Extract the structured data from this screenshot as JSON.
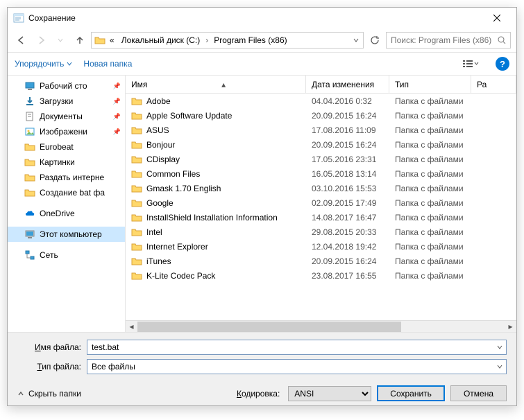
{
  "title": "Сохранение",
  "breadcrumb": {
    "root": "«",
    "seg1": "Локальный диск (C:)",
    "seg2": "Program Files (x86)"
  },
  "search": {
    "placeholder": "Поиск: Program Files (x86)"
  },
  "toolbar": {
    "organize": "Упорядочить",
    "newfolder": "Новая папка"
  },
  "columns": {
    "name": "Имя",
    "date": "Дата изменения",
    "type": "Тип",
    "size": "Ра"
  },
  "sidebar": {
    "quick": [
      {
        "label": "Рабочий сто",
        "pin": true,
        "icon": "desktop"
      },
      {
        "label": "Загрузки",
        "pin": true,
        "icon": "downloads"
      },
      {
        "label": "Документы",
        "pin": true,
        "icon": "documents"
      },
      {
        "label": "Изображени",
        "pin": true,
        "icon": "pictures"
      },
      {
        "label": "Eurobeat",
        "pin": false,
        "icon": "folder"
      },
      {
        "label": "Картинки",
        "pin": false,
        "icon": "folder"
      },
      {
        "label": "Раздать интерне",
        "pin": false,
        "icon": "folder"
      },
      {
        "label": "Создание bat фа",
        "pin": false,
        "icon": "folder"
      }
    ],
    "onedrive": "OneDrive",
    "thispc": "Этот компьютер",
    "network": "Сеть"
  },
  "typeFolder": "Папка с файлами",
  "files": [
    {
      "name": "Adobe",
      "date": "04.04.2016 0:32"
    },
    {
      "name": "Apple Software Update",
      "date": "20.09.2015 16:24"
    },
    {
      "name": "ASUS",
      "date": "17.08.2016 11:09"
    },
    {
      "name": "Bonjour",
      "date": "20.09.2015 16:24"
    },
    {
      "name": "CDisplay",
      "date": "17.05.2016 23:31"
    },
    {
      "name": "Common Files",
      "date": "16.05.2018 13:14"
    },
    {
      "name": "Gmask 1.70 English",
      "date": "03.10.2016 15:53"
    },
    {
      "name": "Google",
      "date": "02.09.2015 17:49"
    },
    {
      "name": "InstallShield Installation Information",
      "date": "14.08.2017 16:47"
    },
    {
      "name": "Intel",
      "date": "29.08.2015 20:33"
    },
    {
      "name": "Internet Explorer",
      "date": "12.04.2018 19:42"
    },
    {
      "name": "iTunes",
      "date": "20.09.2015 16:24"
    },
    {
      "name": "K-Lite Codec Pack",
      "date": "23.08.2017 16:55"
    }
  ],
  "filename": {
    "label": "Имя файла:",
    "value": "test.bat"
  },
  "filetype": {
    "label": "Тип файла:",
    "value": "Все файлы"
  },
  "encoding": {
    "label": "Кодировка:",
    "value": "ANSI"
  },
  "hide": "Скрыть папки",
  "save": "Сохранить",
  "cancel": "Отмена"
}
